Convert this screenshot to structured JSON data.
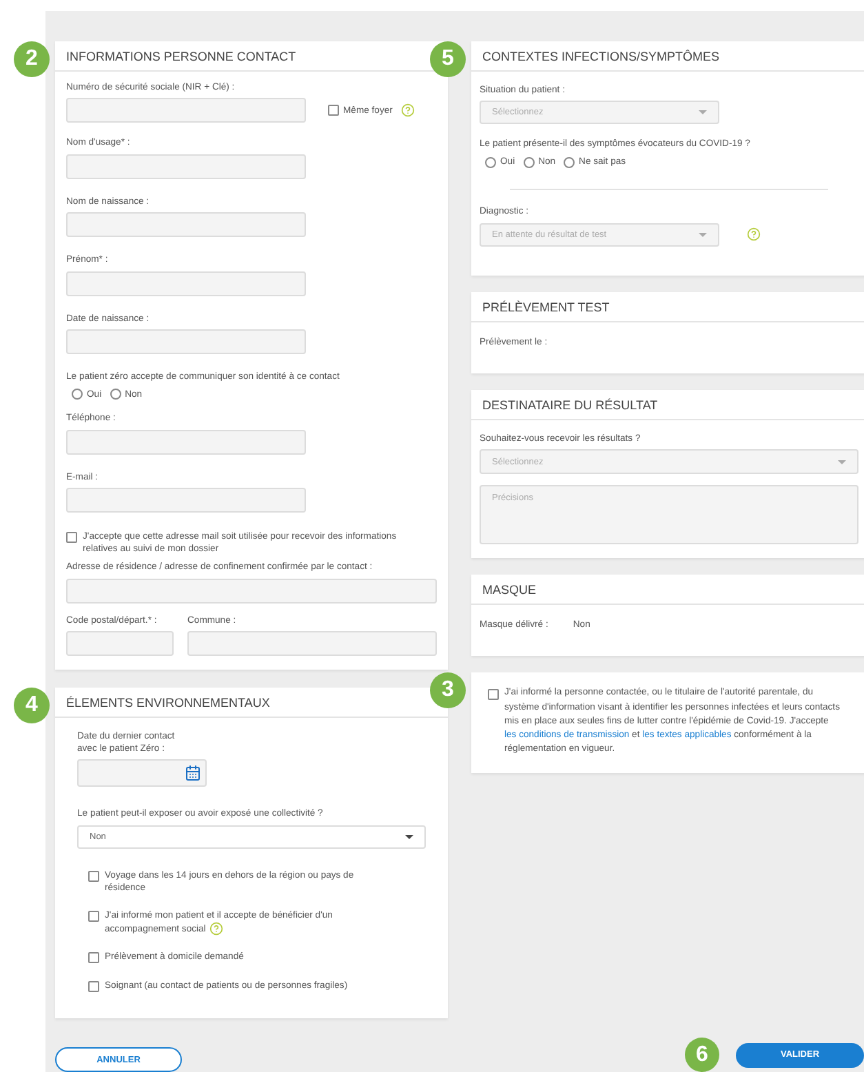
{
  "left_sections": [
    {
      "badge": "2",
      "title": "INFORMATIONS PERSONNE CONTACT",
      "fields": [
        {
          "kind": "input_check",
          "label": "Numéro de sécurité sociale (NIR + Clé) :",
          "checkbox": {
            "label": "Même foyer",
            "checked": false,
            "help": true
          }
        },
        {
          "kind": "input",
          "label": "Nom d'usage* :"
        },
        {
          "kind": "input",
          "label": "Nom de naissance :"
        },
        {
          "kind": "input",
          "label": "Prénom* :"
        },
        {
          "kind": "input",
          "label": "Date de naissance :"
        },
        {
          "kind": "radio",
          "label": "Le patient zéro accepte de communiquer son identité à ce contact",
          "options": [
            {
              "label": "Oui",
              "selected": false
            },
            {
              "label": "Non",
              "selected": false
            }
          ]
        },
        {
          "kind": "input",
          "label": "Téléphone :"
        },
        {
          "kind": "input",
          "label": "E-mail :"
        },
        {
          "kind": "checkbox",
          "label": "J'accepte que cette adresse mail soit utilisée pour recevoir des informations relatives au suivi de mon dossier",
          "checked": false,
          "help": false
        },
        {
          "kind": "wide_input",
          "label": "Adresse de résidence / adresse de confinement confirmée par le contact :"
        },
        {
          "kind": "pair",
          "items": [
            {
              "label": "Code postal/départ.* :"
            },
            {
              "label": "Commune :"
            }
          ]
        }
      ]
    },
    {
      "badge": "4",
      "title": "ÉLEMENTS ENVIRONNEMENTAUX",
      "fields": [
        {
          "kind": "date",
          "label_lines": [
            "Date du dernier contact",
            "avec le patient Zéro :"
          ]
        },
        {
          "kind": "select",
          "label": "Le patient peut-il exposer ou avoir exposé une collectivité ?",
          "value": "Non",
          "disabled": false,
          "help": false
        },
        {
          "kind": "checkbox",
          "label": "Voyage dans les 14 jours en dehors de la région ou pays de résidence",
          "checked": false,
          "help": false
        },
        {
          "kind": "checkbox",
          "label": "J'ai informé mon patient et il accepte de bénéficier d'un accompagnement social",
          "checked": false,
          "help": true
        },
        {
          "kind": "checkbox",
          "label": "Prélèvement à domicile demandé",
          "checked": false,
          "help": false
        },
        {
          "kind": "checkbox",
          "label": "Soignant (au contact de patients ou de personnes fragiles)",
          "checked": false,
          "help": false
        }
      ]
    }
  ],
  "right_sections": [
    {
      "badge": "5",
      "title": "CONTEXTES INFECTIONS/SYMPTÔMES",
      "fields": [
        {
          "kind": "select",
          "label": "Situation du patient :",
          "value": "Sélectionnez",
          "disabled": true,
          "help": false
        },
        {
          "kind": "radio",
          "label": "Le patient présente-il des symptômes évocateurs du COVID-19 ?",
          "options": [
            {
              "label": "Oui",
              "selected": false
            },
            {
              "label": "Non",
              "selected": false
            },
            {
              "label": "Ne sait pas",
              "selected": false
            }
          ]
        },
        {
          "kind": "divider"
        },
        {
          "kind": "select",
          "label": "Diagnostic :",
          "value": "En attente du résultat de test",
          "disabled": true,
          "help": true
        }
      ]
    },
    {
      "title": "PRÉLÈVEMENT TEST",
      "fields": [
        {
          "kind": "readonly",
          "label": "Prélèvement le :"
        }
      ]
    },
    {
      "title": "DESTINATAIRE DU RÉSULTAT",
      "fields": [
        {
          "kind": "wide_select",
          "label": "Souhaitez-vous recevoir les résultats ?",
          "value": "Sélectionnez",
          "disabled": true
        },
        {
          "kind": "textarea",
          "placeholder": "Précisions"
        }
      ]
    },
    {
      "title": "MASQUE",
      "fields": [
        {
          "kind": "readonly",
          "label": "Masque délivré :",
          "value": "Non"
        }
      ]
    },
    {
      "badge": "3",
      "fields": [
        {
          "kind": "consent",
          "checked": false,
          "parts": [
            {
              "kind": "text",
              "text": "J'ai informé la personne contactée, ou le titulaire de l'autorité parentale, du système d'information visant à identifier les personnes infectées et leurs contacts mis en place aux seules fins de lutter contre l'épidémie de Covid-19. J'accepte "
            },
            {
              "kind": "link",
              "text": "les conditions de transmission"
            },
            {
              "kind": "text",
              "text": " et "
            },
            {
              "kind": "link",
              "text": "les textes applicables"
            },
            {
              "kind": "text",
              "text": " conformément à la réglementation en vigueur."
            }
          ]
        }
      ]
    }
  ],
  "buttons": [
    {
      "kind": "secondary",
      "label": "ANNULER"
    },
    {
      "kind": "primary",
      "label": "VALIDER",
      "badge": "6"
    }
  ]
}
